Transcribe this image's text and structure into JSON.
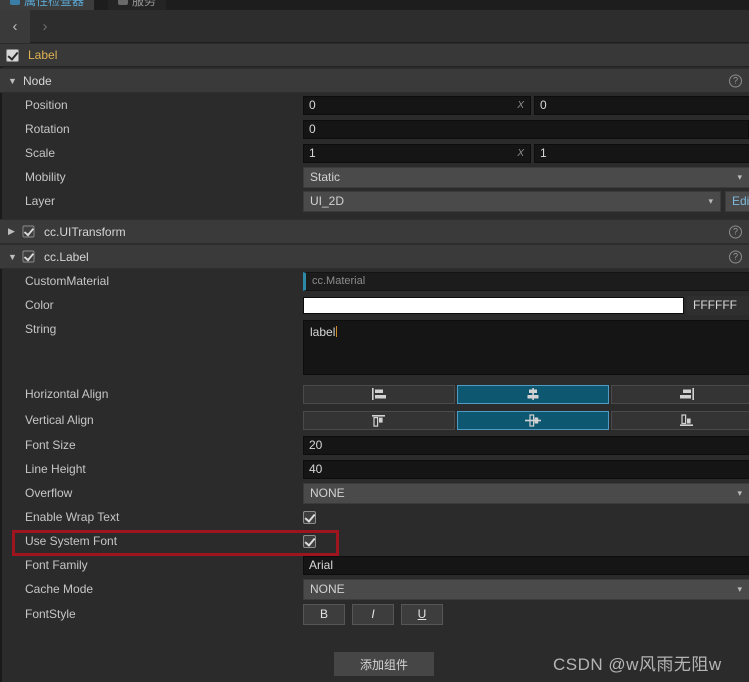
{
  "tabs": [
    {
      "label": "属性检查器",
      "active": true,
      "icon": "inspector-icon"
    },
    {
      "label": "服务",
      "active": false,
      "icon": "services-icon"
    }
  ],
  "nav": {
    "back": "‹",
    "forward": "›"
  },
  "node_header": {
    "name": "Label",
    "enabled": true
  },
  "sections": {
    "node": {
      "title": "Node",
      "expanded": true,
      "help": "?",
      "rows": [
        {
          "label": "Position",
          "type": "vec",
          "x": "0",
          "y": "0",
          "axis_x": "X"
        },
        {
          "label": "Rotation",
          "type": "single",
          "value": "0"
        },
        {
          "label": "Scale",
          "type": "vec",
          "x": "1",
          "y": "1",
          "axis_x": "X"
        },
        {
          "label": "Mobility",
          "type": "combo",
          "value": "Static"
        },
        {
          "label": "Layer",
          "type": "combo_edit",
          "value": "UI_2D",
          "button": "Edit"
        }
      ]
    },
    "uitransform": {
      "title": "cc.UITransform",
      "expanded": false,
      "enabled": true,
      "help": "?"
    },
    "label": {
      "title": "cc.Label",
      "expanded": true,
      "enabled": true,
      "help": "?",
      "rows": {
        "custom_material": {
          "label": "CustomMaterial",
          "value": "cc.Material"
        },
        "color": {
          "label": "Color",
          "hex": "FFFFFF",
          "swatch": "#ffffff"
        },
        "string": {
          "label": "String",
          "value": "label"
        },
        "horizontal_align": {
          "label": "Horizontal Align",
          "options": [
            "left",
            "center",
            "right"
          ],
          "selected": 1
        },
        "vertical_align": {
          "label": "Vertical Align",
          "options": [
            "top",
            "middle",
            "bottom"
          ],
          "selected": 1
        },
        "font_size": {
          "label": "Font Size",
          "value": "20"
        },
        "line_height": {
          "label": "Line Height",
          "value": "40"
        },
        "overflow": {
          "label": "Overflow",
          "value": "NONE"
        },
        "enable_wrap_text": {
          "label": "Enable Wrap Text",
          "checked": true
        },
        "use_system_font": {
          "label": "Use System Font",
          "checked": true,
          "highlight": "#9e1520"
        },
        "font_family": {
          "label": "Font Family",
          "value": "Arial"
        },
        "cache_mode": {
          "label": "Cache Mode",
          "value": "NONE"
        },
        "font_style": {
          "label": "FontStyle",
          "buttons": [
            {
              "label": "B",
              "name": "bold"
            },
            {
              "label": "I",
              "name": "italic"
            },
            {
              "label": "U",
              "name": "underline"
            }
          ]
        }
      }
    }
  },
  "add_component_button": "添加组件",
  "watermark": "CSDN @w风雨无阻w",
  "colors": {
    "accent_teal": "#0d5770",
    "accent_border": "#4e9cc4",
    "highlight_red": "#9e1520",
    "node_name": "#e0b254"
  }
}
